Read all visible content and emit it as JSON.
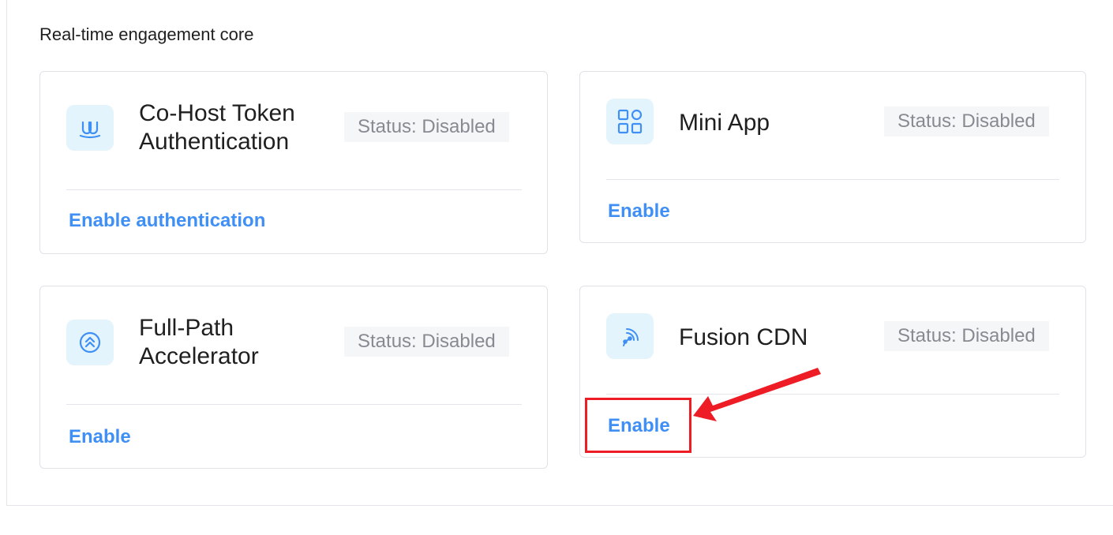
{
  "section": {
    "title": "Real-time engagement core"
  },
  "cards": [
    {
      "title": "Co-Host Token Authentication",
      "title_line1": "Co-Host Token",
      "title_line2": "Authentication",
      "status": "Status: Disabled",
      "action": "Enable authentication",
      "icon": "co-host-icon"
    },
    {
      "title": "Mini App",
      "status": "Status: Disabled",
      "action": "Enable",
      "icon": "mini-app-grid-icon"
    },
    {
      "title": "Full-Path Accelerator",
      "title_line1": "Full-Path",
      "title_line2": "Accelerator",
      "status": "Status: Disabled",
      "action": "Enable",
      "icon": "accelerator-icon"
    },
    {
      "title": "Fusion CDN",
      "status": "Status: Disabled",
      "action": "Enable",
      "icon": "cdn-signal-icon"
    }
  ],
  "colors": {
    "accent": "#3f8ff5",
    "icon_bg": "#e3f4fd",
    "status_bg": "#f5f6f8",
    "status_text": "#878a91",
    "annotation": "#ee1c25"
  },
  "annotation": {
    "target": "Fusion CDN Enable",
    "type": "red-box-and-arrow"
  }
}
